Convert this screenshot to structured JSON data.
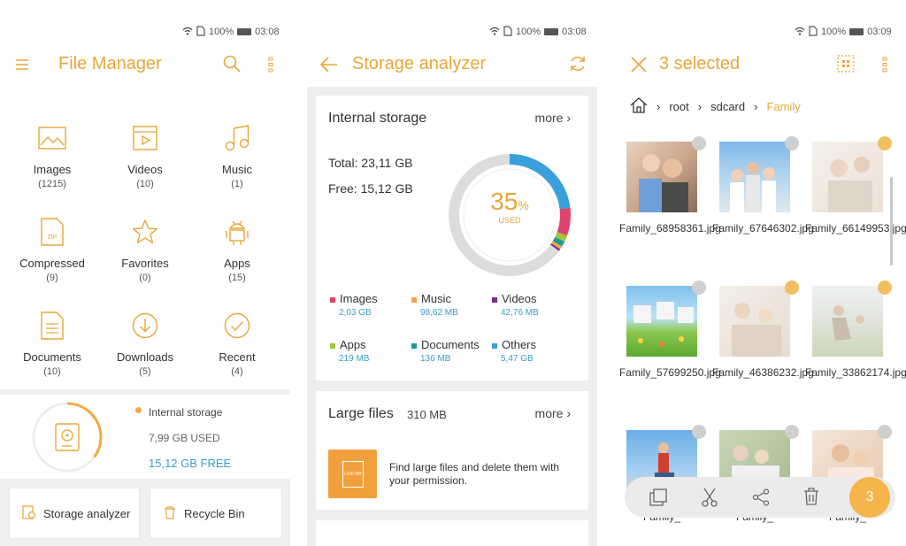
{
  "colors": {
    "accent": "#e7a73a",
    "teal": "#3a9ec3",
    "selected_check": "#f0c060"
  },
  "panel1": {
    "status": {
      "battery": "100%",
      "time": "03:08"
    },
    "title": "File Manager",
    "categories": [
      {
        "label": "Images",
        "count": "(1215)",
        "icon": "image-icon"
      },
      {
        "label": "Videos",
        "count": "(10)",
        "icon": "video-icon"
      },
      {
        "label": "Music",
        "count": "(1)",
        "icon": "music-note-icon"
      },
      {
        "label": "Compressed",
        "count": "(9)",
        "icon": "zip-file-icon"
      },
      {
        "label": "Favorites",
        "count": "(0)",
        "icon": "star-icon"
      },
      {
        "label": "Apps",
        "count": "(15)",
        "icon": "android-icon"
      },
      {
        "label": "Documents",
        "count": "(10)",
        "icon": "document-icon"
      },
      {
        "label": "Downloads",
        "count": "(5)",
        "icon": "download-icon"
      },
      {
        "label": "Recent",
        "count": "(4)",
        "icon": "check-circle-icon"
      }
    ],
    "storage": {
      "name": "Internal storage",
      "used": "7,99 GB USED",
      "free": "15,12 GB FREE",
      "used_fraction": 0.35
    },
    "buttons": {
      "analyzer": "Storage analyzer",
      "recycle": "Recycle Bin"
    }
  },
  "panel2": {
    "status": {
      "battery": "100%",
      "time": "03:08"
    },
    "title": "Storage analyzer",
    "internal": {
      "title": "Internal storage",
      "more": "more",
      "total": "Total: 23,11 GB",
      "free": "Free: 15,12 GB",
      "percent": "35",
      "percent_sign": "%",
      "used_label": "USED",
      "legend": [
        {
          "label": "Images",
          "value": "2,03 GB",
          "color": "#e0436e"
        },
        {
          "label": "Music",
          "value": "98,62 MB",
          "color": "#f3a743"
        },
        {
          "label": "Videos",
          "value": "42,76 MB",
          "color": "#7b2a8a"
        },
        {
          "label": "Apps",
          "value": "219 MB",
          "color": "#a3c43a"
        },
        {
          "label": "Documents",
          "value": "136 MB",
          "color": "#1a9a9a"
        },
        {
          "label": "Others",
          "value": "5,47 GB",
          "color": "#3aa0dc"
        }
      ]
    },
    "large_files": {
      "title": "Large files",
      "size": "310 MB",
      "more": "more",
      "icon_text": "+100 MB",
      "description": "Find large files and delete them with your permission."
    }
  },
  "panel3": {
    "status": {
      "battery": "100%",
      "time": "03:09"
    },
    "title": "3 selected",
    "breadcrumb": [
      "root",
      "sdcard",
      "Family"
    ],
    "files": [
      {
        "name": "Family_68958361.jpg",
        "selected": false
      },
      {
        "name": "Family_67646302.jpg",
        "selected": false
      },
      {
        "name": "Family_66149953.jpg",
        "selected": true
      },
      {
        "name": "Family_57699250.jpg",
        "selected": false
      },
      {
        "name": "Family_46386232.jpg",
        "selected": true
      },
      {
        "name": "Family_33862174.jpg",
        "selected": true
      },
      {
        "name": "Family_",
        "selected": false
      },
      {
        "name": "Family_",
        "selected": false
      },
      {
        "name": "Family_",
        "selected": false
      }
    ],
    "fab_count": "3"
  }
}
